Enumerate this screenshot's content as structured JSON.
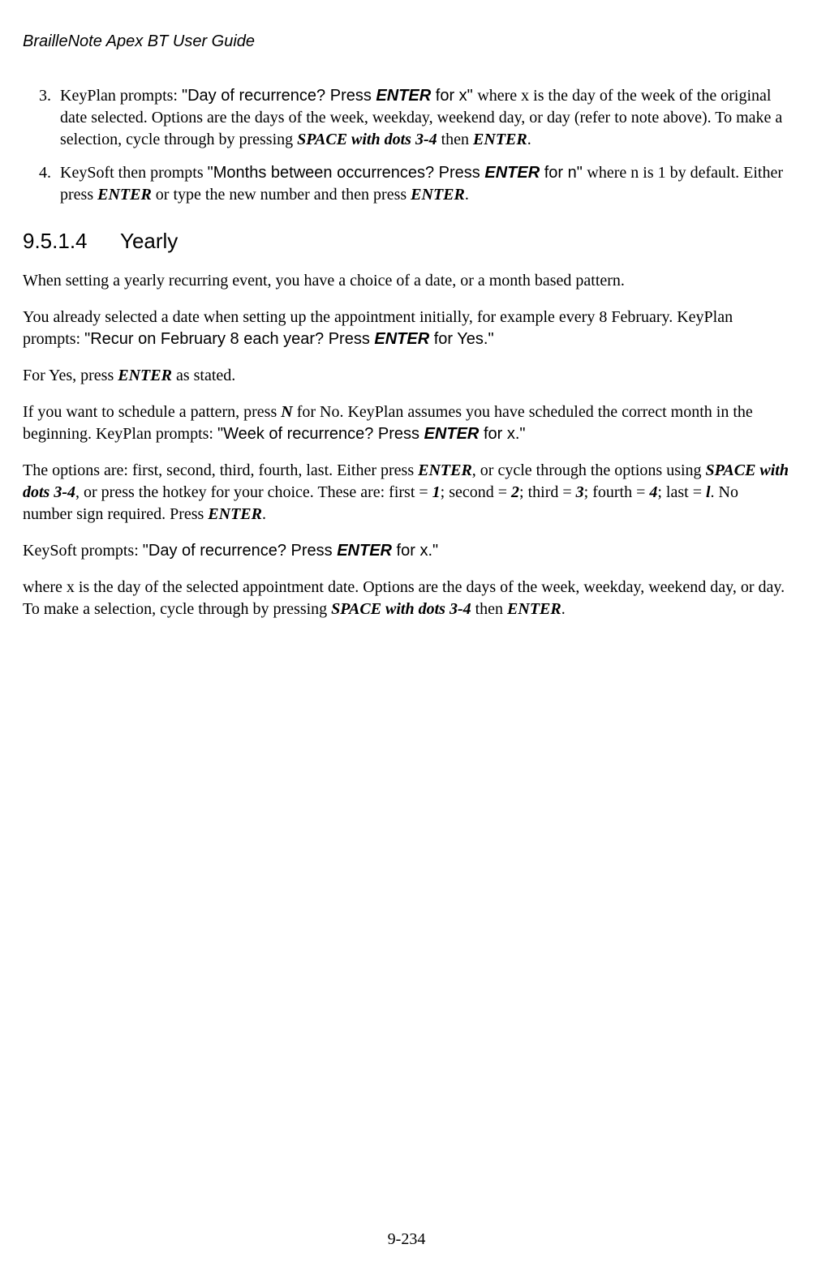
{
  "header": {
    "title": "BrailleNote Apex BT User Guide"
  },
  "list": {
    "start": 3,
    "items": [
      {
        "t1": "KeyPlan prompts: ",
        "q1a": "\"Day of recurrence? Press ",
        "q1k": "ENTER",
        "q1b": " for x\" ",
        "t2a": "where x is the day of the week of the original date selected. Options are the days of the week, weekday, weekend day, or day (refer to note above). To make a selection, cycle through by pressing ",
        "k1": "SPACE with dots 3-4",
        "t2b": " then ",
        "k2": "ENTER",
        "t2c": "."
      },
      {
        "t1": "KeySoft then prompts ",
        "q1a": "\"Months between occurrences? Press ",
        "q1k": "ENTER",
        "q1b": " for n\" ",
        "t2a": "where n is 1 by default. Either press ",
        "k1": "ENTER",
        "t2b": " or type the new number and then press ",
        "k2": "ENTER",
        "t2c": "."
      }
    ]
  },
  "section": {
    "number": "9.5.1.4",
    "title": "Yearly"
  },
  "p1": {
    "t": "When setting a yearly recurring event, you have a choice of a date, or a month based pattern."
  },
  "p2": {
    "t1": "You already selected a date when setting up the appointment initially, for example every 8 February. KeyPlan prompts: ",
    "qa": "\"Recur on February 8 each year? Press ",
    "qk": "ENTER",
    "qb": " for Yes.\""
  },
  "p3": {
    "t1": "For Yes, press ",
    "k1": "ENTER",
    "t2": " as stated."
  },
  "p4": {
    "t1": "If you want to schedule a pattern, press ",
    "k1": "N",
    "t2": " for No. KeyPlan assumes you have scheduled the correct month in the beginning. KeyPlan prompts: ",
    "qa": "\"Week of recurrence? Press ",
    "qk": "ENTER",
    "qb": " for x.\""
  },
  "p5": {
    "t1": "The options are: first, second, third, fourth, last. Either press ",
    "k1": "ENTER",
    "t2": ", or cycle through the options using ",
    "k2": "SPACE with dots 3-4",
    "t3": ", or press the hotkey for your choice. These are: first = ",
    "k3": "1",
    "t4": "; second = ",
    "k4": "2",
    "t5": "; third = ",
    "k5": "3",
    "t6": "; fourth = ",
    "k6": "4",
    "t7": "; last = ",
    "k7": "l",
    "t8": ". No number sign required. Press ",
    "k8": "ENTER",
    "t9": "."
  },
  "p6": {
    "t1": "KeySoft prompts: ",
    "qa": "\"Day of recurrence? Press ",
    "qk": "ENTER",
    "qb": " for x.\""
  },
  "p7": {
    "t1": "where x is the day of the selected appointment date. Options are the days of the week, weekday, weekend day, or day. To make a selection, cycle through by pressing ",
    "k1": "SPACE with dots 3-4",
    "t2": " then ",
    "k2": "ENTER",
    "t3": "."
  },
  "footer": {
    "page": "9-234"
  }
}
